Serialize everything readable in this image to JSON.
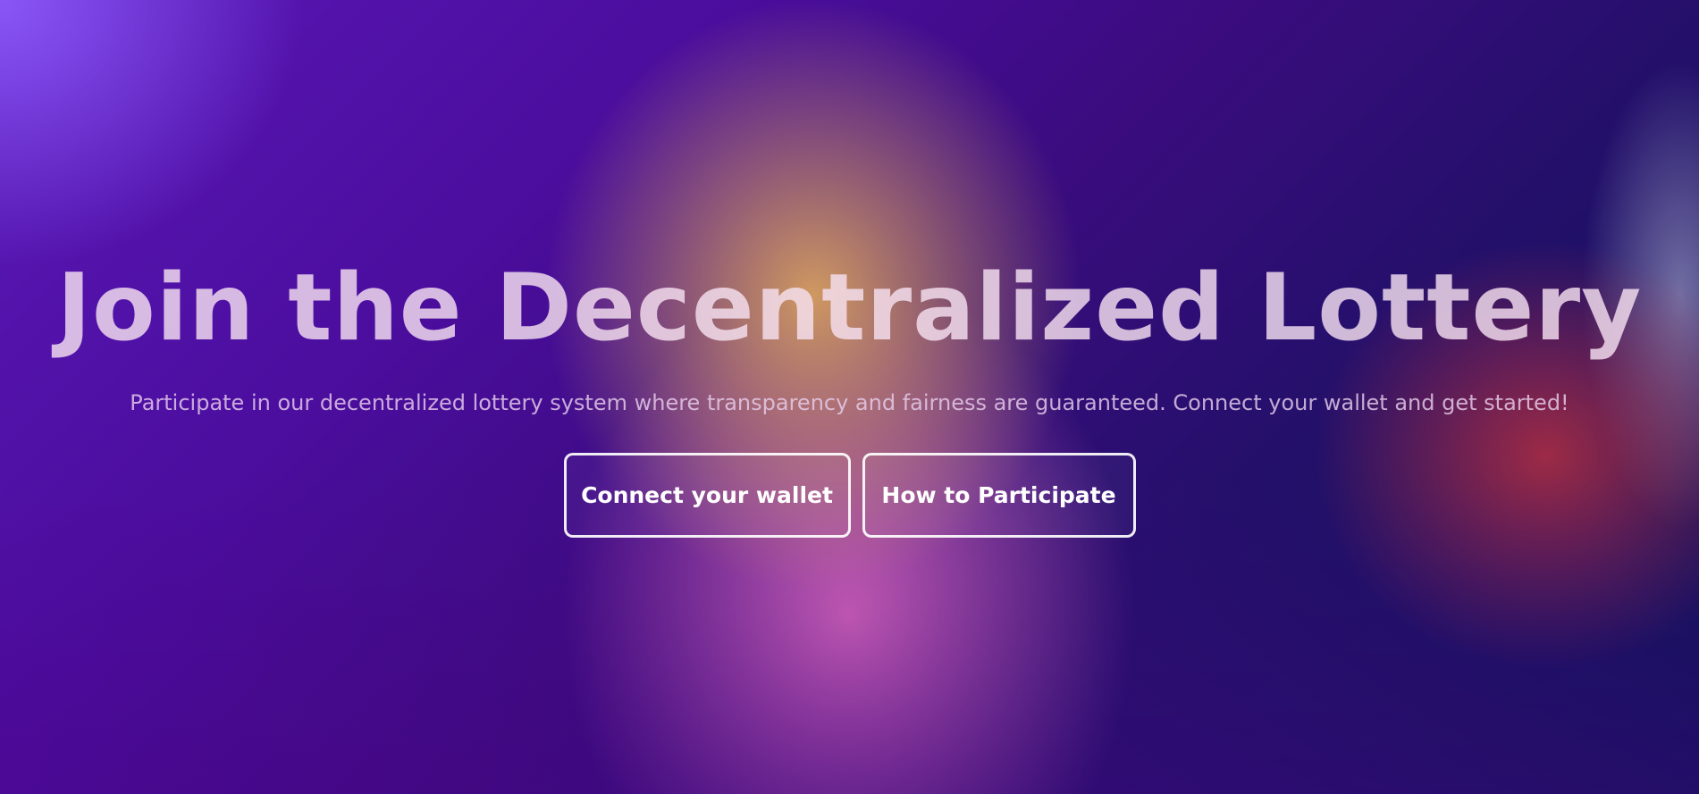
{
  "hero": {
    "title": "Join the Decentralized Lottery",
    "subtitle": "Participate in our decentralized lottery system where transparency and fairness are guaranteed. Connect your wallet and get started!",
    "buttons": [
      {
        "label": "Connect your wallet"
      },
      {
        "label": "How to Participate"
      }
    ]
  },
  "colors": {
    "background_start": "#5a18b8",
    "background_end": "#0b1555",
    "glow_orange": "#d7a05f",
    "glow_pink": "#e16ebe",
    "glow_red": "#c8323c",
    "button_border": "#ffffff"
  }
}
